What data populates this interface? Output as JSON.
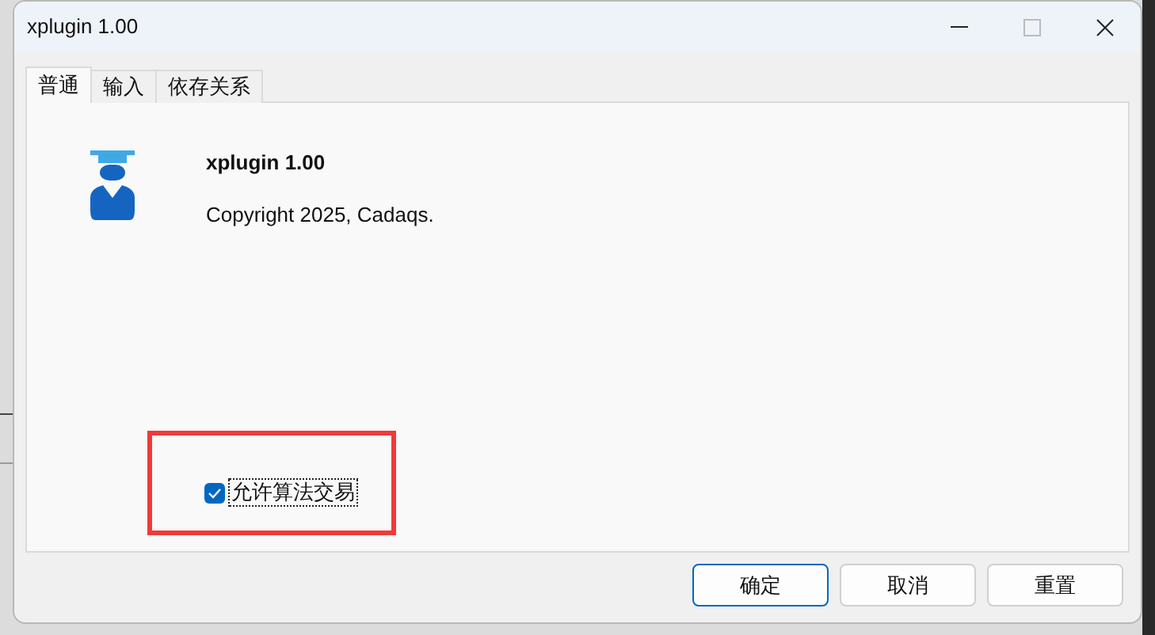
{
  "window": {
    "title": "xplugin 1.00"
  },
  "tabs": [
    {
      "label": "普通",
      "selected": true
    },
    {
      "label": "输入",
      "selected": false
    },
    {
      "label": "依存关系",
      "selected": false
    }
  ],
  "about": {
    "name": "xplugin 1.00",
    "copyright": "Copyright 2025, Cadaqs."
  },
  "option": {
    "label": "允许算法交易",
    "checked": true
  },
  "buttons": [
    {
      "label": "确定",
      "default": true
    },
    {
      "label": "取消",
      "default": false
    },
    {
      "label": "重置",
      "default": false
    }
  ]
}
